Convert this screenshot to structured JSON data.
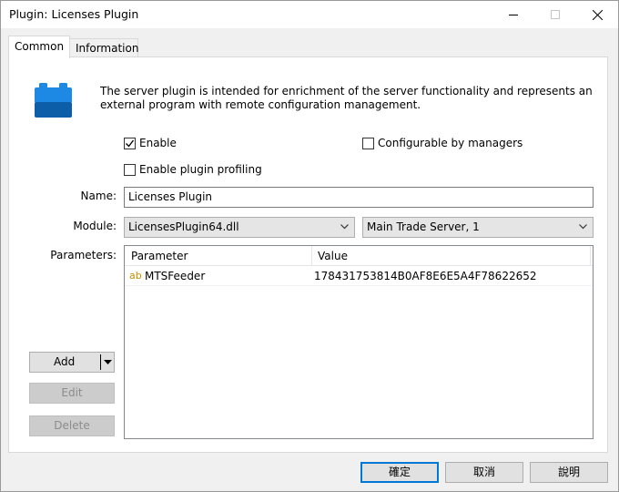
{
  "window": {
    "title": "Plugin: Licenses Plugin"
  },
  "tabs": [
    {
      "label": "Common",
      "active": true
    },
    {
      "label": "Information",
      "active": false
    }
  ],
  "description": "The server plugin is intended for enrichment of the server functionality and represents an external program with remote configuration management.",
  "checkboxes": {
    "enable": {
      "label": "Enable",
      "checked": true
    },
    "configurable": {
      "label": "Configurable by managers",
      "checked": false
    },
    "profiling": {
      "label": "Enable plugin profiling",
      "checked": false
    }
  },
  "fields": {
    "name_label": "Name:",
    "name_value": "Licenses Plugin",
    "module_label": "Module:",
    "module_value": "LicensesPlugin64.dll",
    "server_value": "Main Trade Server, 1",
    "parameters_label": "Parameters:"
  },
  "parameters": {
    "columns": [
      "Parameter",
      "Value"
    ],
    "rows": [
      {
        "type_icon": "ab",
        "parameter": "MTSFeeder",
        "value": "178431753814B0AF8E6E5A4F78622652"
      }
    ]
  },
  "buttons": {
    "add": "Add",
    "edit": "Edit",
    "delete": "Delete",
    "ok": "確定",
    "cancel": "取消",
    "help": "說明"
  },
  "colors": {
    "accent": "#0078d7",
    "icon_blue": "#1e88e5",
    "type_icon": "#c58b00"
  }
}
